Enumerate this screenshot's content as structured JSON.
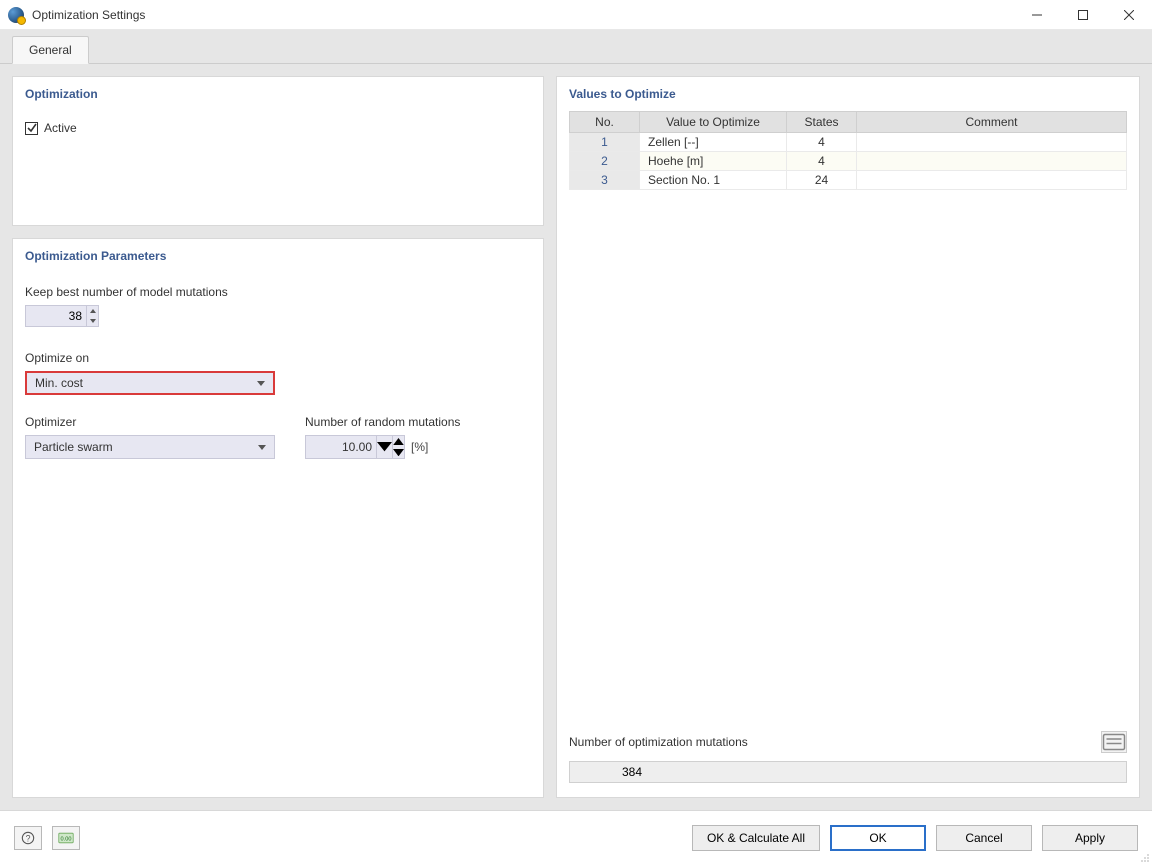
{
  "window": {
    "title": "Optimization Settings"
  },
  "tabs": [
    {
      "label": "General"
    }
  ],
  "left": {
    "optimization": {
      "title": "Optimization",
      "active_label": "Active",
      "active_checked": true
    },
    "params": {
      "title": "Optimization Parameters",
      "keep_best_label": "Keep best number of model mutations",
      "keep_best_value": "38",
      "optimize_on_label": "Optimize on",
      "optimize_on_value": "Min. cost",
      "optimizer_label": "Optimizer",
      "optimizer_value": "Particle swarm",
      "random_mut_label": "Number of random mutations",
      "random_mut_value": "10.00",
      "random_mut_unit": "[%]"
    }
  },
  "right": {
    "title": "Values to Optimize",
    "headers": {
      "no": "No.",
      "value": "Value to Optimize",
      "states": "States",
      "comment": "Comment"
    },
    "rows": [
      {
        "no": "1",
        "value": "Zellen [--]",
        "states": "4",
        "comment": ""
      },
      {
        "no": "2",
        "value": "Hoehe [m]",
        "states": "4",
        "comment": ""
      },
      {
        "no": "3",
        "value": "Section No. 1",
        "states": "24",
        "comment": ""
      }
    ],
    "total_label": "Number of optimization mutations",
    "total_value": "384"
  },
  "footer": {
    "ok_calc": "OK & Calculate All",
    "ok": "OK",
    "cancel": "Cancel",
    "apply": "Apply"
  }
}
